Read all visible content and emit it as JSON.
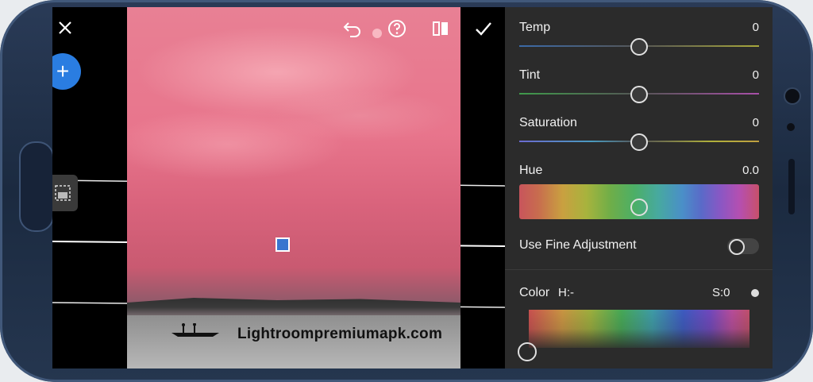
{
  "toolbar": {
    "close_icon": "close-icon",
    "undo_icon": "undo-icon",
    "help_icon": "help-icon",
    "compare_icon": "compare-icon",
    "confirm_icon": "checkmark-icon"
  },
  "watermark": "Lightroompremiumapk.com",
  "panel": {
    "temp": {
      "label": "Temp",
      "value": "0",
      "level": 0.5
    },
    "tint": {
      "label": "Tint",
      "value": "0",
      "level": 0.5
    },
    "saturation": {
      "label": "Saturation",
      "value": "0",
      "level": 0.5
    },
    "hue": {
      "label": "Hue",
      "value": "0.0",
      "level": 0.5
    },
    "fine_adjustment": {
      "label": "Use Fine Adjustment",
      "enabled": false
    },
    "color": {
      "label": "Color",
      "h_label": "H:-",
      "s_label": "S:0"
    }
  },
  "colors": {
    "accent": "#2a7de1",
    "panel_bg": "#2b2b2b",
    "handle": "#3875cf"
  }
}
